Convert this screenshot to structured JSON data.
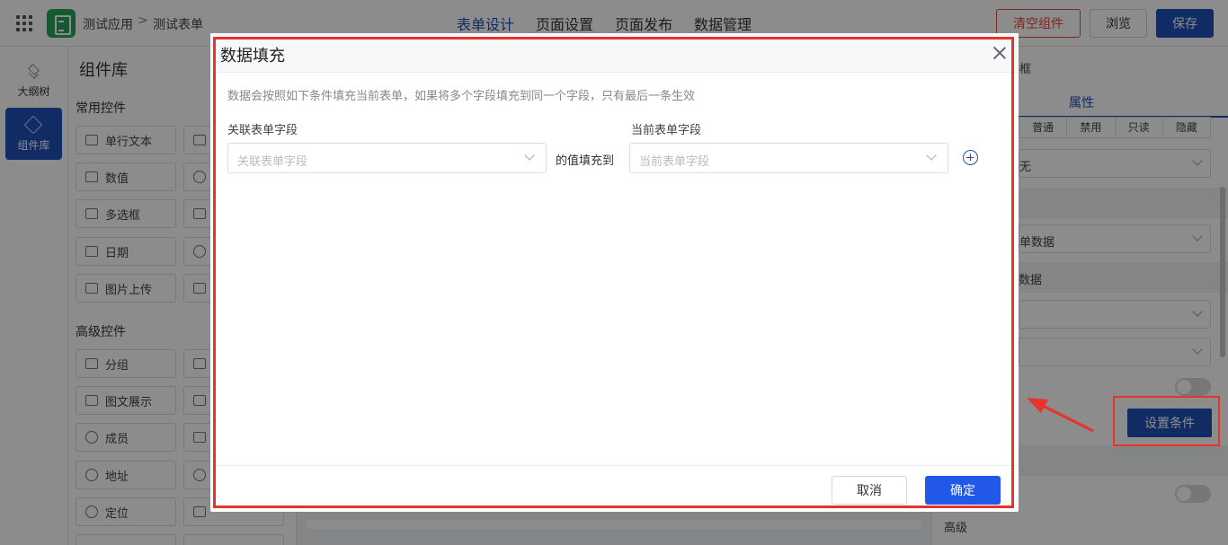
{
  "topbar": {
    "breadcrumb": [
      "测试应用",
      "测试表单"
    ],
    "breadcrumb_separator": ">",
    "tabs": [
      {
        "label": "表单设计",
        "active": true
      },
      {
        "label": "页面设置",
        "active": false
      },
      {
        "label": "页面发布",
        "active": false
      },
      {
        "label": "数据管理",
        "active": false
      }
    ],
    "clear_label": "清空组件",
    "browse_label": "浏览",
    "save_label": "保存"
  },
  "rail": {
    "items": [
      {
        "label": "大纲树",
        "icon": "layers-icon",
        "active": false
      },
      {
        "label": "组件库",
        "icon": "cube-icon",
        "active": true
      }
    ]
  },
  "library": {
    "title": "组件库",
    "common_section": "常用控件",
    "advanced_section": "高级控件",
    "common_items": [
      "单行文本",
      "数值",
      "多选框",
      "日期",
      "图片上传"
    ],
    "advanced_items": [
      "分组",
      "图文展示",
      "成员",
      "地址",
      "定位"
    ]
  },
  "right_panel": {
    "top_label": "框",
    "attr_tab": "属性",
    "segments": [
      "普通",
      "禁用",
      "只读",
      "隐藏"
    ],
    "select_1": "无",
    "select_2": "单数据",
    "band_2": "数据",
    "set_condition_label": "设置条件",
    "advanced_label": "高级"
  },
  "modal": {
    "title": "数据填充",
    "description": "数据会按照如下条件填充当前表单，如果将多个字段填充到同一个字段，只有最后一条生效",
    "left_label": "关联表单字段",
    "left_placeholder": "关联表单字段",
    "middle_text": "的值填充到",
    "right_label": "当前表单字段",
    "right_placeholder": "当前表单字段",
    "cancel_label": "取消",
    "ok_label": "确定"
  },
  "colors": {
    "primary": "#1f4fb6",
    "ok_button": "#2158e8",
    "danger": "#e24a3a",
    "annotation": "#e8322a"
  }
}
